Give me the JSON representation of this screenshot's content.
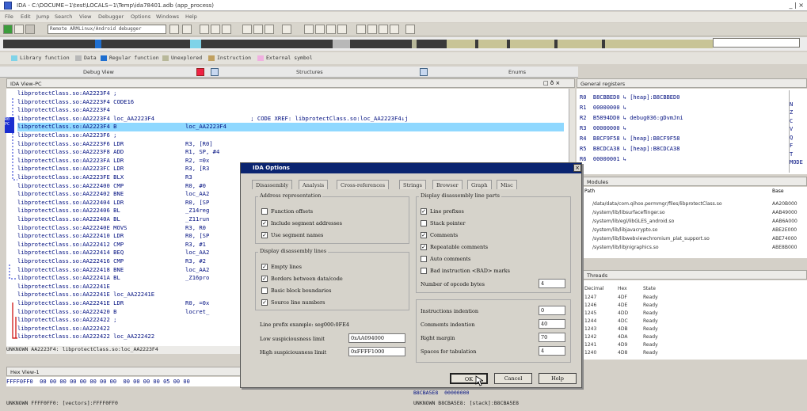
{
  "window": {
    "title": "IDA - C:\\DOCUME~1\\test\\LOCALS~1\\Temp\\ida78401.adb (app_process)",
    "controls": "_ | ×"
  },
  "menu": [
    "File",
    "Edit",
    "Jump",
    "Search",
    "View",
    "Debugger",
    "Options",
    "Windows",
    "Help"
  ],
  "toolbar": {
    "debugger_combo": "Remote ARMLinux/Android debugger"
  },
  "legend": [
    {
      "label": "Library function",
      "color": "#7fd3e8"
    },
    {
      "label": "Data",
      "color": "#b8b8b8"
    },
    {
      "label": "Regular function",
      "color": "#1f6fd0"
    },
    {
      "label": "Unexplored",
      "color": "#b8b89a"
    },
    {
      "label": "Instruction",
      "color": "#c0a060"
    },
    {
      "label": "External symbol",
      "color": "#f0b0e0"
    }
  ],
  "tabs": {
    "debug_view": "Debug View",
    "structures": "Structures",
    "enums": "Enums"
  },
  "ida_view": {
    "title": "IDA View-PC",
    "lines": [
      "libprotectClass.so:AA2223F4 ;",
      "libprotectClass.so:AA2223F4 CODE16",
      "libprotectClass.so:AA2223F4",
      "libprotectClass.so:AA2223F4 loc_AA2223F4                            ; CODE XREF: libprotectClass.so:loc_AA2223F4↓j",
      "libprotectClass.so:AA2223F4 B                    loc_AA2223F4",
      "libprotectClass.so:AA2223F6 ;",
      "libprotectClass.so:AA2223F6 LDR                  R3, [R0]",
      "libprotectClass.so:AA2223F8 ADD                  R1, SP, #4",
      "libprotectClass.so:AA2223FA LDR                  R2, =0x",
      "libprotectClass.so:AA2223FC LDR                  R3, [R3",
      "libprotectClass.so:AA2223FE BLX                  R3",
      "libprotectClass.so:AA222400 CMP                  R0, #0",
      "libprotectClass.so:AA222402 BNE                  loc_AA2",
      "libprotectClass.so:AA222404 LDR                  R0, [SP",
      "libprotectClass.so:AA222406 BL                   _Z14reg",
      "libprotectClass.so:AA22240A BL                   _Z11run",
      "libprotectClass.so:AA22240E MOVS                 R3, R0",
      "libprotectClass.so:AA222410 LDR                  R0, [SP",
      "libprotectClass.so:AA222412 CMP                  R3, #1",
      "libprotectClass.so:AA222414 BEQ                  loc_AA2",
      "libprotectClass.so:AA222416 CMP                  R3, #2",
      "libprotectClass.so:AA222418 BNE                  loc_AA2",
      "libprotectClass.so:AA22241A BL                   _Z16pro",
      "libprotectClass.so:AA22241E",
      "libprotectClass.so:AA22241E loc_AA22241E",
      "libprotectClass.so:AA22241E LDR                  R0, =0x",
      "libprotectClass.so:AA222420 B                    locret_",
      "libprotectClass.so:AA222422 ;",
      "libprotectClass.so:AA222422",
      "libprotectClass.so:AA222422 loc_AA222422"
    ],
    "status": "UNKNOWN AA2223F4: libprotectClass.so:loc_AA2223F4"
  },
  "registers": {
    "title": "General registers",
    "rows": [
      "R0  B8CBBED0 ↳ [heap]:B8CBBED0",
      "R1  00000000 ↳",
      "R2  B5894DD0 ↳ debug036:gDvmJni",
      "R3  00000000 ↳",
      "R4  B8CF9F58 ↳ [heap]:B8CF9F58",
      "R5  B8CDCA38 ↳ [heap]:B8CDCA38",
      "R6  00000001 ↳"
    ],
    "flags": [
      "N",
      "Z",
      "C",
      "V",
      "Q",
      "F",
      "T",
      "MODE"
    ]
  },
  "modules": {
    "title": "Modules",
    "headers": {
      "path": "Path",
      "base": "Base"
    },
    "rows": [
      {
        "path": "/data/data/com.qihoo.permmgr/files/libprotectClass.so",
        "base": "AA20B000"
      },
      {
        "path": "/system/lib/libsurfaceflinger.so",
        "base": "AAB49000"
      },
      {
        "path": "/system/lib/egl/libGLES_android.so",
        "base": "AAB6A000"
      },
      {
        "path": "/system/lib/libjavacrypto.so",
        "base": "ABE2E000"
      },
      {
        "path": "/system/lib/libwebviewchromium_plat_support.so",
        "base": "ABE74000"
      },
      {
        "path": "/system/lib/libjnigraphics.so",
        "base": "ABE8B000"
      }
    ]
  },
  "threads": {
    "title": "Threads",
    "headers": {
      "decimal": "Decimal",
      "hex": "Hex",
      "state": "State"
    },
    "rows": [
      {
        "dec": "1247",
        "hex": "4DF",
        "state": "Ready"
      },
      {
        "dec": "1246",
        "hex": "4DE",
        "state": "Ready"
      },
      {
        "dec": "1245",
        "hex": "4DD",
        "state": "Ready"
      },
      {
        "dec": "1244",
        "hex": "4DC",
        "state": "Ready"
      },
      {
        "dec": "1243",
        "hex": "4DB",
        "state": "Ready"
      },
      {
        "dec": "1242",
        "hex": "4DA",
        "state": "Ready"
      },
      {
        "dec": "1241",
        "hex": "4D9",
        "state": "Ready"
      },
      {
        "dec": "1240",
        "hex": "4D8",
        "state": "Ready"
      }
    ]
  },
  "hex_view": {
    "title": "Hex View-1",
    "line": "FFFF0FF0  00 00 00 00 00 00 00 00  00 00 00 00 05 00 00",
    "status": "UNKNOWN FFFF0FF0: [vectors]:FFFF0FF0"
  },
  "stack_status": "UNKNOWN B8CBA5E8: [stack]:B8CBA5E8",
  "stack_line": "B8CBA5E8  00000000",
  "dialog": {
    "title": "IDA Options",
    "tabs": [
      "Disassembly",
      "Analysis",
      "Cross-references",
      "Strings",
      "Browser",
      "Graph",
      "Misc"
    ],
    "address_group": "Address representation",
    "address_opts": [
      {
        "label": "Function offsets",
        "checked": false
      },
      {
        "label": "Include segment addresses",
        "checked": true
      },
      {
        "label": "Use segment names",
        "checked": true
      }
    ],
    "lines_group": "Display disassembly lines",
    "lines_opts": [
      {
        "label": "Empty lines",
        "checked": true
      },
      {
        "label": "Borders between data/code",
        "checked": true
      },
      {
        "label": "Basic block boundaries",
        "checked": false
      },
      {
        "label": "Source line numbers",
        "checked": true
      }
    ],
    "parts_group": "Display disassembly line parts",
    "parts_opts": [
      {
        "label": "Line prefixes",
        "checked": true
      },
      {
        "label": "Stack pointer",
        "checked": false
      },
      {
        "label": "Comments",
        "checked": true
      },
      {
        "label": "Repeatable comments",
        "checked": true
      },
      {
        "label": "Auto comments",
        "checked": false
      },
      {
        "label": "Bad instruction <BAD> marks",
        "checked": false
      }
    ],
    "opcode_label": "Number of opcode bytes",
    "opcode_value": "4",
    "prefix_example": "Line prefix example: seg000:0FE4",
    "low_label": "Low suspiciousness limit",
    "low_value": "0xAA094000",
    "high_label": "High suspiciousness limit",
    "high_value": "0xFFFF1000",
    "indent_fields": [
      {
        "label": "Instructions indention",
        "value": "0"
      },
      {
        "label": "Comments indention",
        "value": "40"
      },
      {
        "label": "Right margin",
        "value": "70"
      },
      {
        "label": "Spaces for tabulation",
        "value": "4"
      }
    ],
    "buttons": {
      "ok": "OK",
      "cancel": "Cancel",
      "help": "Help"
    },
    "close": "×"
  }
}
